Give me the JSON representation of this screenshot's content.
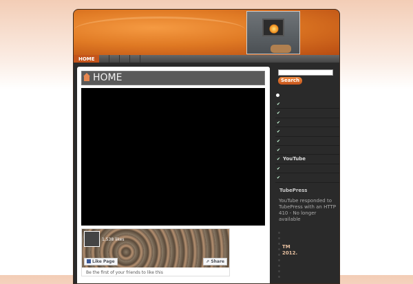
{
  "nav": {
    "home": "HOME"
  },
  "page": {
    "title": "HOME"
  },
  "facebook": {
    "likes": "1,538 likes",
    "like_page": "Like Page",
    "share": "Share",
    "friends_text": "Be the first of your friends to like this"
  },
  "sidebar": {
    "search_placeholder": "",
    "search_button": "Search",
    "links": [
      "",
      "",
      "",
      "",
      "",
      "",
      "YouTube",
      "",
      ""
    ],
    "tubepress_heading": "TubePress",
    "tubepress_text": "YouTube responded to TubePress with an HTTP 410 - No longer available",
    "footer_tm": "TM",
    "footer_year": "2012."
  },
  "colors": {
    "accent": "#c4541b",
    "body": "#2a2a2a"
  }
}
